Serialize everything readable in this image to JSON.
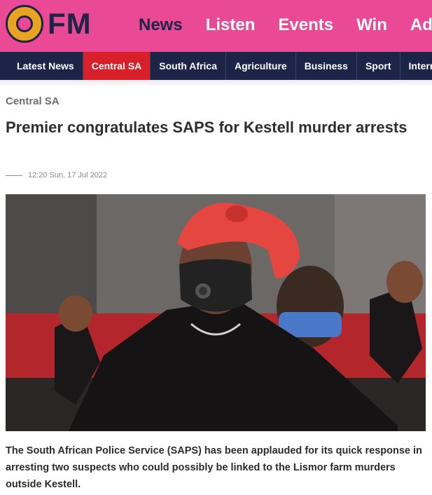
{
  "header": {
    "logo_text": "FM",
    "nav": [
      {
        "label": "News",
        "active": true
      },
      {
        "label": "Listen",
        "active": false
      },
      {
        "label": "Events",
        "active": false
      },
      {
        "label": "Win",
        "active": false
      },
      {
        "label": "Adv",
        "active": false
      }
    ]
  },
  "subnav": {
    "items": [
      {
        "label": "Latest News",
        "active": false
      },
      {
        "label": "Central SA",
        "active": true
      },
      {
        "label": "South Africa",
        "active": false
      },
      {
        "label": "Agriculture",
        "active": false
      },
      {
        "label": "Business",
        "active": false
      },
      {
        "label": "Sport",
        "active": false
      },
      {
        "label": "Intern",
        "active": false
      }
    ]
  },
  "article": {
    "category": "Central SA",
    "title": "Premier congratulates SAPS for Kestell murder arrests",
    "date": "12:20 Sun, 17 Jul 2022",
    "lead": "The South African Police Service (SAPS) has been applauded for its quick response in arresting two suspects who could possibly be linked to the Lismor farm murders outside Kestell."
  },
  "colors": {
    "header_bg": "#ea4a95",
    "nav_bg": "#1c2447",
    "active_tab": "#d9202a",
    "logo_orange": "#e8a321"
  }
}
